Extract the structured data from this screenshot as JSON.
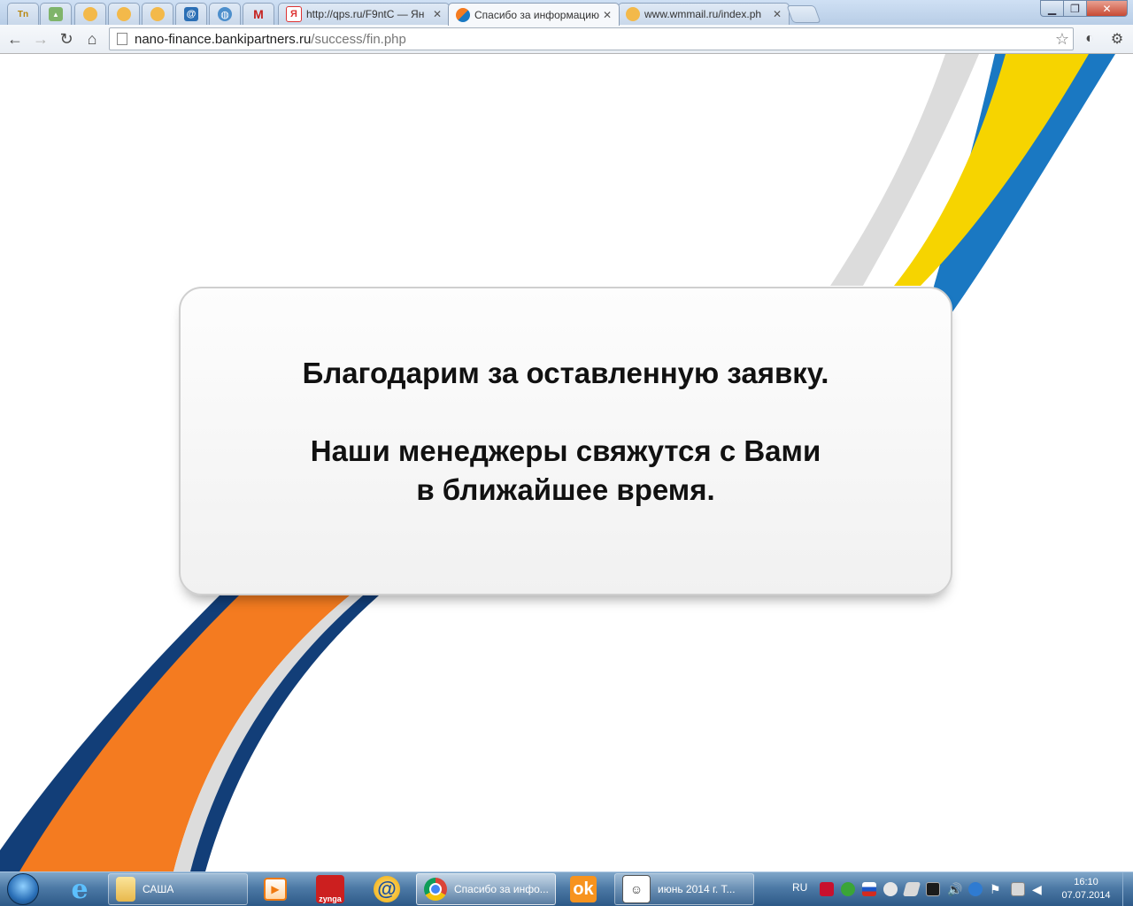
{
  "browser": {
    "tabs": [
      {
        "icon": "tabletki-icon",
        "label": ""
      },
      {
        "icon": "uploader-icon",
        "label": ""
      },
      {
        "icon": "webmoney-icon",
        "label": ""
      },
      {
        "icon": "webmoney-icon",
        "label": ""
      },
      {
        "icon": "webmoney-icon",
        "label": ""
      },
      {
        "icon": "mail-at-icon",
        "label": ""
      },
      {
        "icon": "globe-icon",
        "label": ""
      },
      {
        "icon": "gmail-icon",
        "label": ""
      },
      {
        "icon": "yandex-icon",
        "label": "http://qps.ru/F9ntC — Ян"
      },
      {
        "icon": "bankipartners-icon",
        "label": "Спасибо за информацию"
      },
      {
        "icon": "webmoney-icon",
        "label": "www.wmmail.ru/index.ph"
      }
    ],
    "address": {
      "host": "nano-finance.bankipartners.ru",
      "path": "/success/fin.php"
    }
  },
  "page": {
    "line1": "Благодарим за оставленную заявку.",
    "line2": "Наши менеджеры свяжутся с Вами",
    "line3": "в ближайшее время."
  },
  "taskbar": {
    "items": [
      {
        "icon": "ie-icon",
        "label": ""
      },
      {
        "icon": "folder-icon",
        "label": "САША"
      },
      {
        "icon": "media-player-icon",
        "label": ""
      },
      {
        "icon": "zynga-icon",
        "label": "zynga"
      },
      {
        "icon": "mail-agent-icon",
        "label": "@"
      },
      {
        "icon": "chrome-icon",
        "label": "Спасибо за инфо..."
      },
      {
        "icon": "odnoklassniki-icon",
        "label": ""
      },
      {
        "icon": "calendar-app-icon",
        "label": "июнь 2014 г.    Т..."
      }
    ],
    "language": "RU",
    "time": "16:10",
    "date": "07.07.2014"
  },
  "colors": {
    "ribbon_blue": "#1a78c2",
    "ribbon_yellow": "#f6d400",
    "ribbon_gray": "#dcdcdc",
    "ribbon_orange": "#f47b20",
    "ribbon_navy": "#123e78"
  }
}
